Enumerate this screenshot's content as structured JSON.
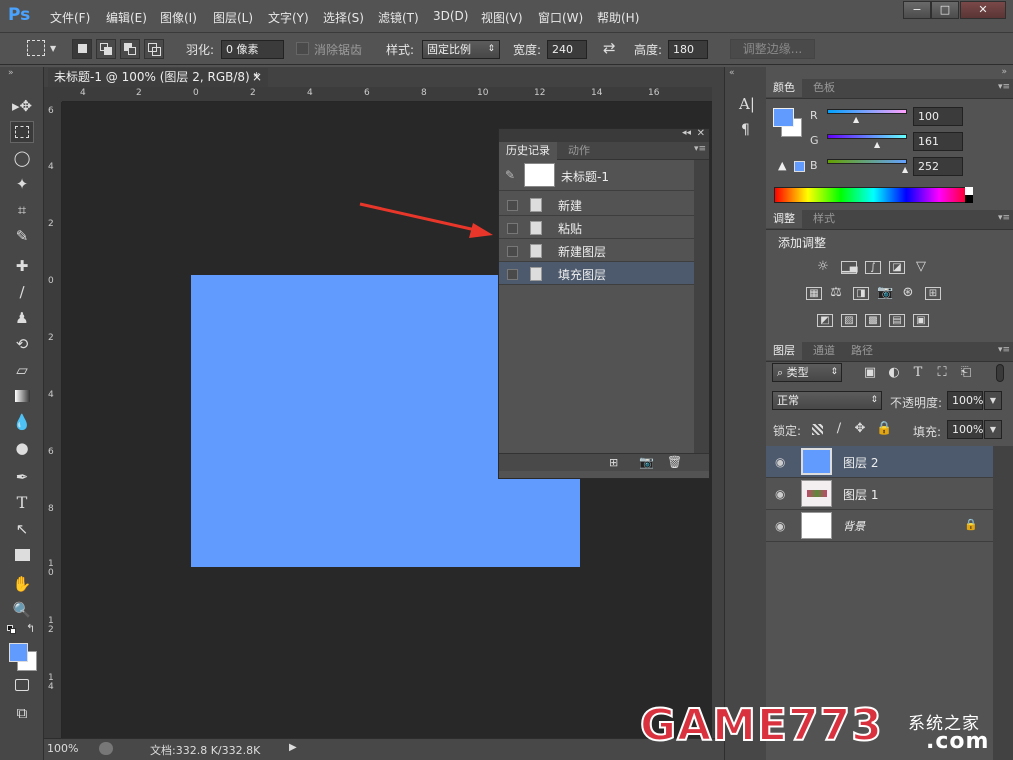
{
  "app": {
    "logo": "Ps"
  },
  "menu": [
    "文件(F)",
    "编辑(E)",
    "图像(I)",
    "图层(L)",
    "文字(Y)",
    "选择(S)",
    "滤镜(T)",
    "3D(D)",
    "视图(V)",
    "窗口(W)",
    "帮助(H)"
  ],
  "window_controls": {
    "minimize": "−",
    "maximize": "□",
    "close": "✕"
  },
  "options": {
    "feather_label": "羽化:",
    "feather_value": "0 像素",
    "antialias_label": "消除锯齿",
    "style_label": "样式:",
    "style_value": "固定比例",
    "width_label": "宽度:",
    "width_value": "240",
    "height_label": "高度:",
    "height_value": "180",
    "refine_edge_label": "调整边缘..."
  },
  "document": {
    "tab_title": "未标题-1 @ 100% (图层 2, RGB/8) *",
    "close": "×",
    "fill_color": "#619bfd"
  },
  "ruler_top": [
    "4",
    "2",
    "0",
    "2",
    "4",
    "6",
    "8",
    "10",
    "12",
    "14",
    "16"
  ],
  "ruler_left": [
    "6",
    "4",
    "2",
    "0",
    "2",
    "4",
    "6",
    "8",
    "1 0",
    "1 2",
    "1 4"
  ],
  "status": {
    "zoom": "100%",
    "doc_info": "文档:332.8 K/332.8K"
  },
  "history_panel": {
    "tabs": [
      "历史记录",
      "动作"
    ],
    "snapshot": "未标题-1",
    "items": [
      "新建",
      "粘贴",
      "新建图层",
      "填充图层"
    ]
  },
  "color_panel": {
    "tabs": [
      "颜色",
      "色板"
    ],
    "r_label": "R",
    "g_label": "G",
    "b_label": "B",
    "r": "100",
    "g": "161",
    "b": "252",
    "foreground": "#619bfd",
    "background": "#ffffff"
  },
  "adjust_panel": {
    "tabs": [
      "调整",
      "样式"
    ],
    "title": "添加调整"
  },
  "layers_panel": {
    "tabs": [
      "图层",
      "通道",
      "路径"
    ],
    "filter": "类型",
    "blend_mode": "正常",
    "opacity_label": "不透明度:",
    "opacity": "100%",
    "lock_label": "锁定:",
    "fill_label": "填充:",
    "fill": "100%",
    "layers": [
      {
        "name": "图层 2"
      },
      {
        "name": "图层 1"
      },
      {
        "name": "背景"
      }
    ]
  },
  "watermark": {
    "text": "GAME773",
    "suffix": "系统之家",
    "domain": ".com"
  }
}
